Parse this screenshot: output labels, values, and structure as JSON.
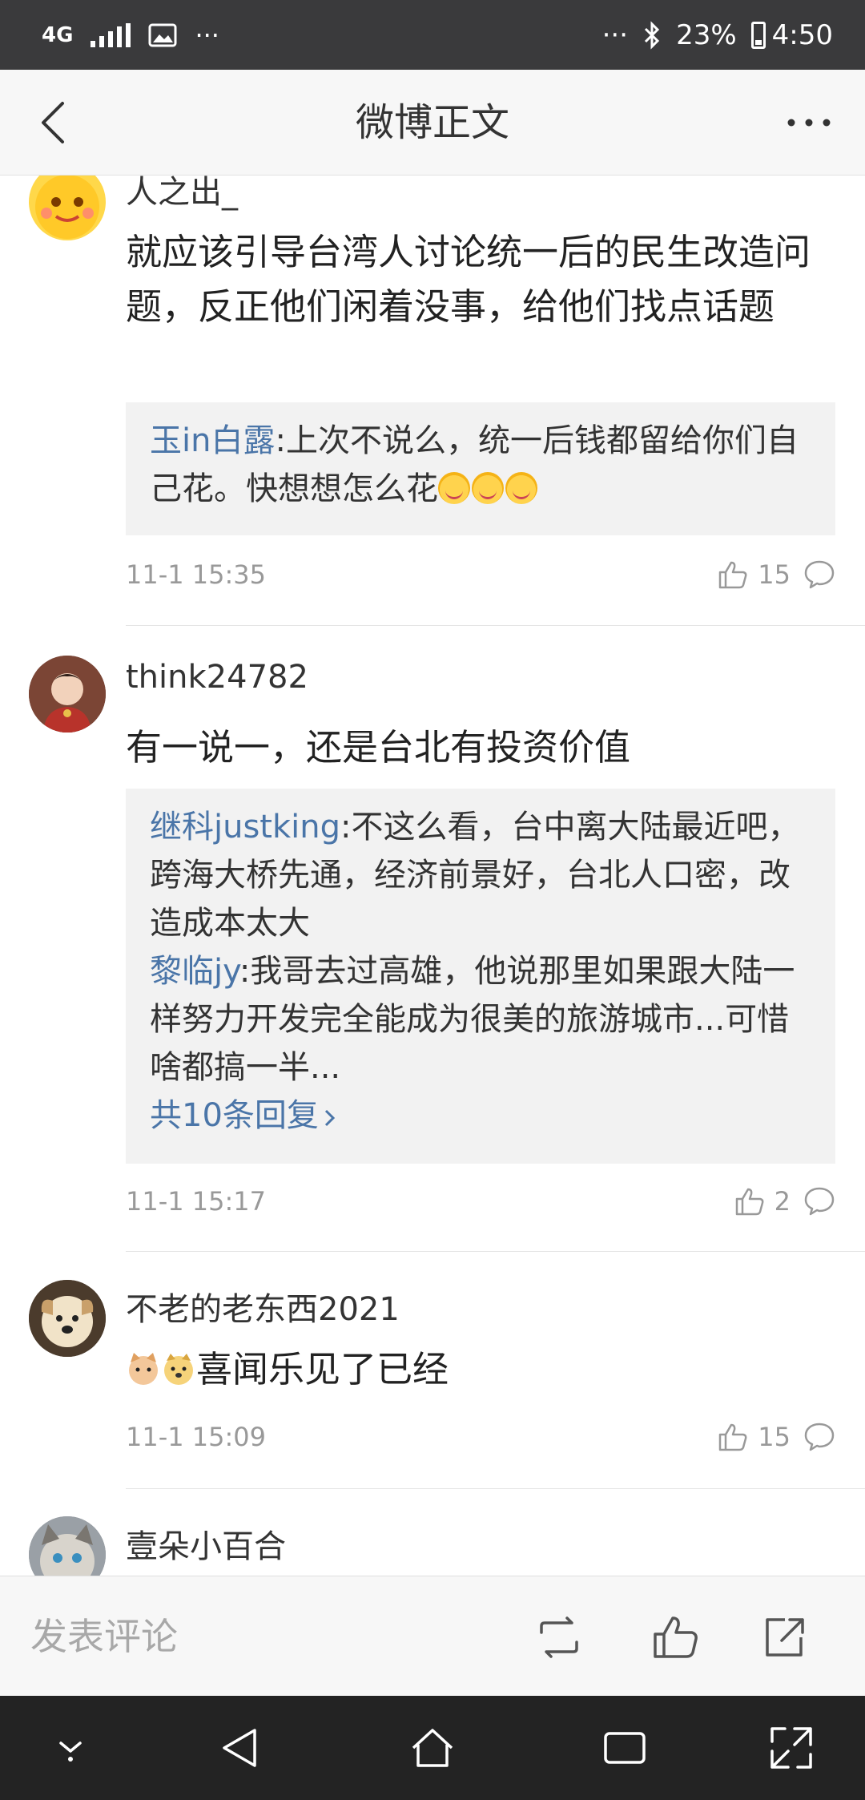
{
  "status_bar": {
    "network": "4G",
    "left_more": "···",
    "right_more": "···",
    "battery": "23%",
    "time": "4:50"
  },
  "header": {
    "title": "微博正文"
  },
  "comments": [
    {
      "username": "人之出_",
      "text": "就应该引导台湾人讨论统一后的民生改造问题，反正他们闲着没事，给他们找点话题",
      "replies": [
        {
          "user": "玉in白露",
          "text": ":上次不说么，统一后钱都留给你们自己花。快想想怎么花"
        }
      ],
      "time": "11-1 15:35",
      "likes": "15"
    },
    {
      "username": "think24782",
      "text": "有一说一，还是台北有投资价值",
      "replies": [
        {
          "user": "继科justking",
          "text": ":不这么看，台中离大陆最近吧，跨海大桥先通，经济前景好，台北人口密，改造成本太大"
        },
        {
          "user": "黎临jy",
          "text": ":我哥去过高雄，他说那里如果跟大陆一样努力开发完全能成为很美的旅游城市...可惜啥都搞一半..."
        }
      ],
      "more_replies": "共10条回复",
      "time": "11-1 15:17",
      "likes": "2"
    },
    {
      "username": "不老的老东西2021",
      "text": "喜闻乐见了已经",
      "time": "11-1 15:09",
      "likes": "15"
    },
    {
      "username": "壹朵小百合"
    }
  ],
  "bottom_bar": {
    "placeholder": "发表评论"
  }
}
